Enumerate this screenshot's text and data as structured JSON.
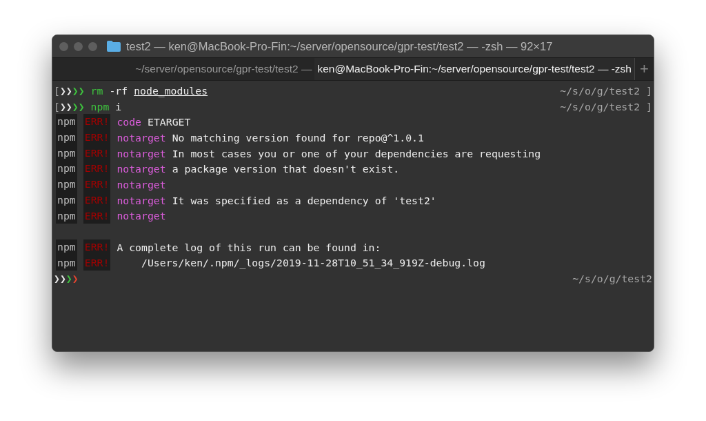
{
  "window": {
    "title": "test2 — ken@MacBook-Pro-Fin:~/server/opensource/gpr-test/test2 — -zsh — 92×17"
  },
  "tabs": [
    {
      "label": "~/server/opensource/gpr-test/test2 —",
      "selected": false
    },
    {
      "label": "ken@MacBook-Pro-Fin:~/server/opensource/gpr-test/test2 — -zsh",
      "selected": true
    }
  ],
  "new_tab_button": "+",
  "lines": [
    {
      "kind": "prompt",
      "bracket_open": "[",
      "chevrons": [
        {
          "glyph": "❯",
          "color": "#e8e8e8"
        },
        {
          "glyph": "❯",
          "color": "#e8e8e8"
        },
        {
          "glyph": "❯",
          "color": "#3ec23e"
        },
        {
          "glyph": "❯",
          "color": "#3ec23e"
        }
      ],
      "command": [
        {
          "kind": "program",
          "text": "rm"
        },
        {
          "kind": "flag",
          "text": "-rf"
        },
        {
          "kind": "path",
          "text": "node_modules"
        }
      ],
      "cwd": "~/s/o/g/test2",
      "bracket_close": "]"
    },
    {
      "kind": "prompt",
      "bracket_open": "[",
      "chevrons": [
        {
          "glyph": "❯",
          "color": "#e8e8e8"
        },
        {
          "glyph": "❯",
          "color": "#e8e8e8"
        },
        {
          "glyph": "❯",
          "color": "#3ec23e"
        },
        {
          "glyph": "❯",
          "color": "#3ec23e"
        }
      ],
      "command": [
        {
          "kind": "program",
          "text": "npm"
        },
        {
          "kind": "flag",
          "text": "i"
        }
      ],
      "cwd": "~/s/o/g/test2",
      "bracket_close": "]"
    },
    {
      "kind": "npm",
      "source": "npm",
      "label": "ERR!",
      "tag": "code",
      "message": "ETARGET"
    },
    {
      "kind": "npm",
      "source": "npm",
      "label": "ERR!",
      "tag": "notarget",
      "message": "No matching version found for repo@^1.0.1"
    },
    {
      "kind": "npm",
      "source": "npm",
      "label": "ERR!",
      "tag": "notarget",
      "message": "In most cases you or one of your dependencies are requesting"
    },
    {
      "kind": "npm",
      "source": "npm",
      "label": "ERR!",
      "tag": "notarget",
      "message": "a package version that doesn't exist."
    },
    {
      "kind": "npm",
      "source": "npm",
      "label": "ERR!",
      "tag": "notarget"
    },
    {
      "kind": "npm",
      "source": "npm",
      "label": "ERR!",
      "tag": "notarget",
      "message": "It was specified as a dependency of 'test2'"
    },
    {
      "kind": "npm",
      "source": "npm",
      "label": "ERR!",
      "tag": "notarget"
    },
    {
      "kind": "blank"
    },
    {
      "kind": "npm",
      "source": "npm",
      "label": "ERR!",
      "message": "A complete log of this run can be found in:"
    },
    {
      "kind": "npm",
      "source": "npm",
      "label": "ERR!",
      "message": "    /Users/ken/.npm/_logs/2019-11-28T10_51_34_919Z-debug.log"
    },
    {
      "kind": "prompt",
      "chevrons": [
        {
          "glyph": "❯",
          "color": "#e8e8e8"
        },
        {
          "glyph": "❯",
          "color": "#e8e8e8"
        },
        {
          "glyph": "❯",
          "color": "#3ec23e"
        },
        {
          "glyph": "❯",
          "color": "#e0452f"
        }
      ],
      "cwd": "~/s/o/g/test2"
    }
  ]
}
